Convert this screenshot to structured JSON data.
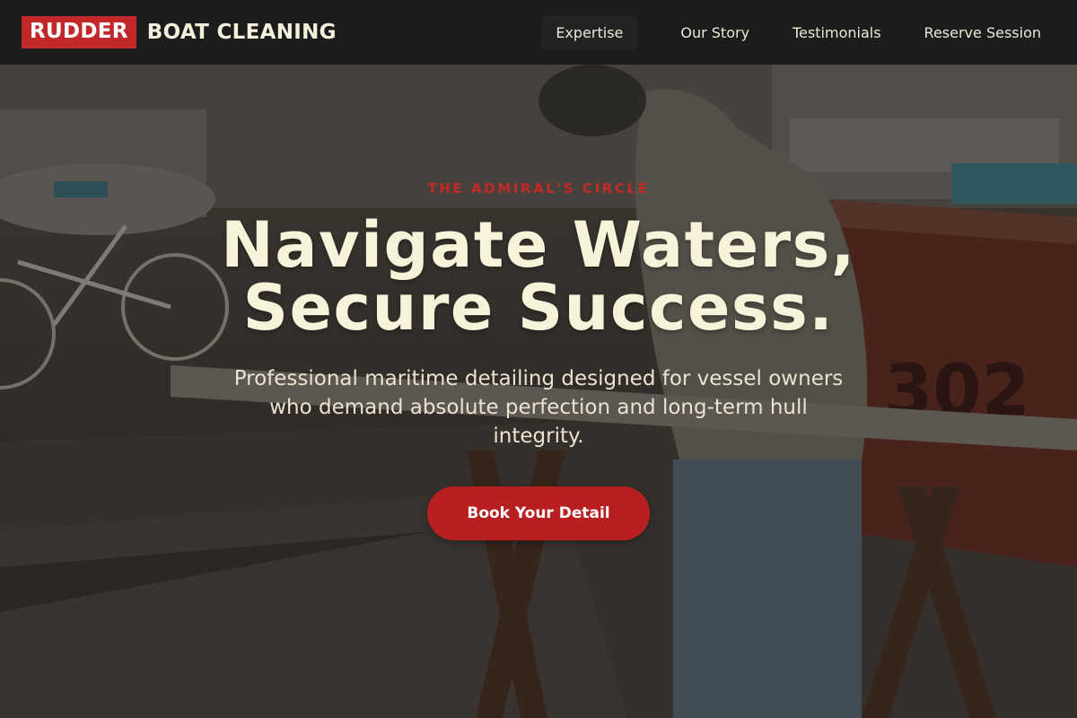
{
  "brand": {
    "badge": "RUDDER",
    "rest": "BOAT CLEANING"
  },
  "nav": {
    "items": [
      {
        "label": "Expertise"
      },
      {
        "label": "Our Story"
      },
      {
        "label": "Testimonials"
      },
      {
        "label": "Reserve Session"
      }
    ]
  },
  "hero": {
    "eyebrow": "THE ADMIRAL'S CIRCLE",
    "headline_line1": "Navigate Waters,",
    "headline_line2": "Secure Success.",
    "subtitle": "Professional maritime detailing designed for vessel owners who demand absolute perfection and long-term hull integrity.",
    "cta_label": "Book Your Detail",
    "background_image": "worker-sawing-plank-at-marina-photo"
  },
  "colors": {
    "header_bg": "#1c1c1c",
    "brand_red": "#c0282a",
    "cream": "#f6f3da",
    "cta_red": "#b81f21"
  }
}
